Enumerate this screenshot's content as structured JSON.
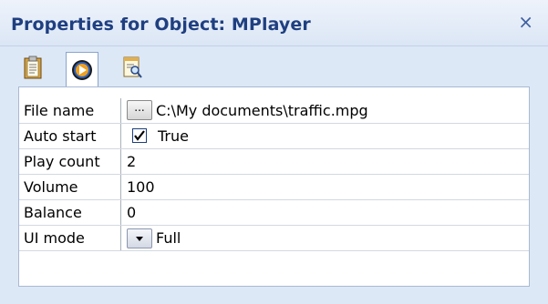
{
  "panel": {
    "title": "Properties for Object: MPlayer",
    "close_glyph": "×"
  },
  "toolbar": {
    "tabs": [
      {
        "icon": "clipboard-icon",
        "active": false
      },
      {
        "icon": "media-player-icon",
        "active": true
      },
      {
        "icon": "document-search-icon",
        "active": false
      }
    ]
  },
  "properties": {
    "file_name": {
      "label": "File name",
      "button": "...",
      "value": "C:\\My documents\\traffic.mpg"
    },
    "auto_start": {
      "label": "Auto start",
      "checked": true,
      "value": "True"
    },
    "play_count": {
      "label": "Play count",
      "value": "2"
    },
    "volume": {
      "label": "Volume",
      "value": "100"
    },
    "balance": {
      "label": "Balance",
      "value": "0"
    },
    "ui_mode": {
      "label": "UI mode",
      "value": "Full"
    }
  },
  "colors": {
    "title": "#1f3f80",
    "panel_bg": "#dde8f6",
    "grid_border": "#a9b9d4"
  }
}
